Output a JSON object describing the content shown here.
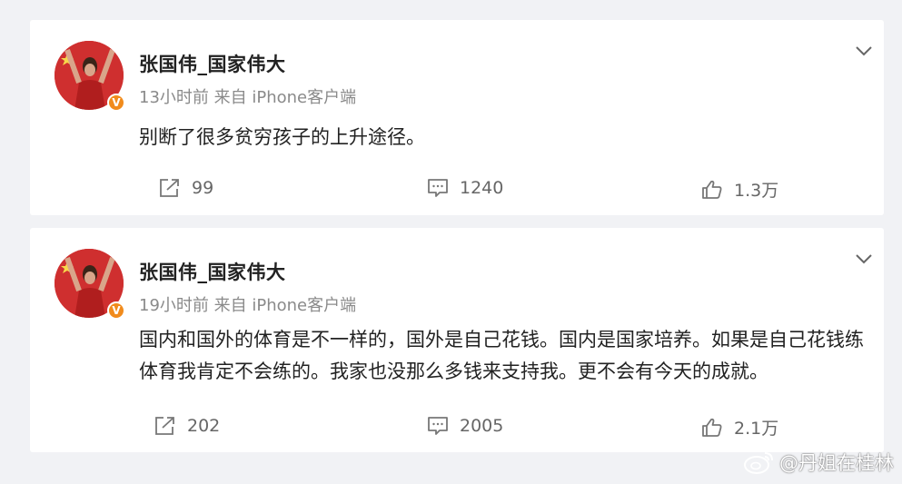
{
  "posts": [
    {
      "author": "张国伟_国家伟大",
      "meta": "13小时前 来自 iPhone客户端",
      "content": "别断了很多贫穷孩子的上升途径。",
      "reposts": "99",
      "comments": "1240",
      "likes": "1.3万"
    },
    {
      "author": "张国伟_国家伟大",
      "meta": "19小时前 来自 iPhone客户端",
      "content": "国内和国外的体育是不一样的，国外是自己花钱。国内是国家培养。如果是自己花钱练体育我肯定不会练的。我家也没那么多钱来支持我。更不会有今天的成就。",
      "reposts": "202",
      "comments": "2005",
      "likes": "2.1万"
    }
  ],
  "badge": "V",
  "watermark": "@丹姐在桂林",
  "icons": {
    "repost": "repost-icon",
    "comment": "comment-icon",
    "like": "like-icon",
    "more": "chevron-down-icon",
    "verified": "verified-badge-icon",
    "weibo": "weibo-logo-icon"
  },
  "colors": {
    "background": "#f1f2f5",
    "card": "#ffffff",
    "text": "#222222",
    "meta": "#8a8a8a",
    "badge": "#f18b1c"
  }
}
